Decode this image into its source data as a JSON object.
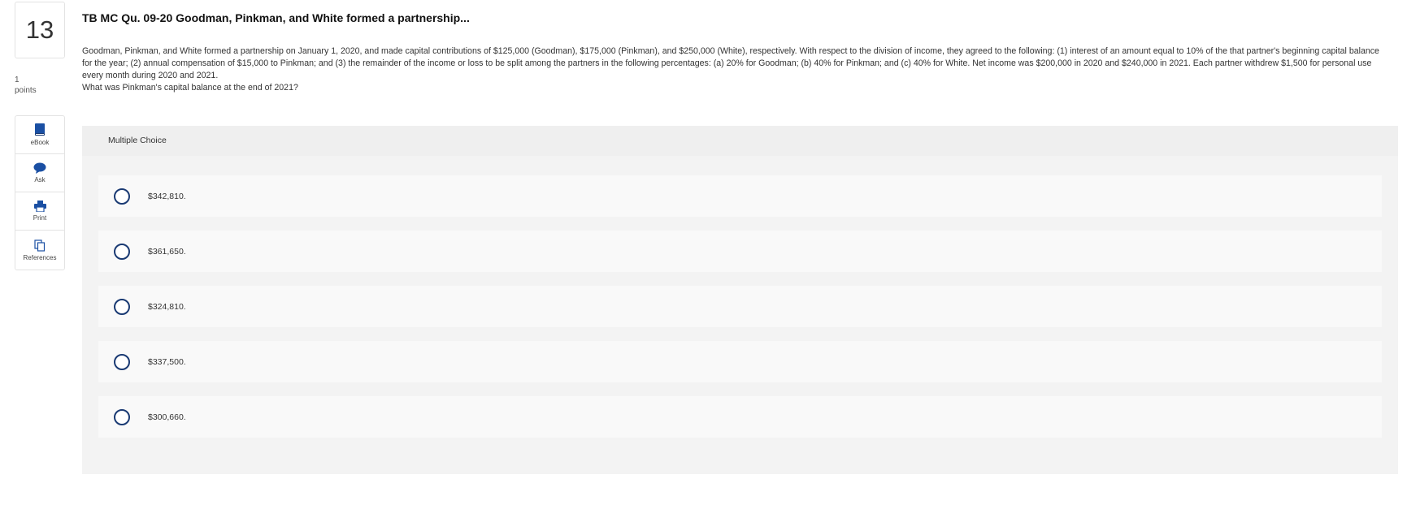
{
  "question": {
    "number": "13",
    "points_value": "1",
    "points_label": "points",
    "title": "TB MC Qu. 09-20 Goodman, Pinkman, and White formed a partnership...",
    "stem": "Goodman, Pinkman, and White formed a partnership on January 1, 2020, and made capital contributions of $125,000 (Goodman), $175,000 (Pinkman), and $250,000 (White), respectively. With respect to the division of income, they agreed to the following: (1) interest of an amount equal to 10% of the that partner's beginning capital balance for the year; (2) annual compensation of $15,000 to Pinkman; and (3) the remainder of the income or loss to be split among the partners in the following percentages: (a) 20% for Goodman; (b) 40% for Pinkman; and (c) 40% for White. Net income was $200,000 in 2020 and $240,000 in 2021. Each partner withdrew $1,500 for personal use every month during 2020 and 2021.",
    "prompt": "What was Pinkman's capital balance at the end of 2021?"
  },
  "tools": [
    {
      "label": "eBook",
      "icon": "book-icon"
    },
    {
      "label": "Ask",
      "icon": "chat-bubble-icon"
    },
    {
      "label": "Print",
      "icon": "printer-icon"
    },
    {
      "label": "References",
      "icon": "documents-icon"
    }
  ],
  "multiple_choice": {
    "header": "Multiple Choice",
    "options": [
      "$342,810.",
      "$361,650.",
      "$324,810.",
      "$337,500.",
      "$300,660."
    ]
  },
  "colors": {
    "accent": "#1a3a73",
    "panel": "#efefef",
    "option_bg": "#f9f9f9"
  }
}
